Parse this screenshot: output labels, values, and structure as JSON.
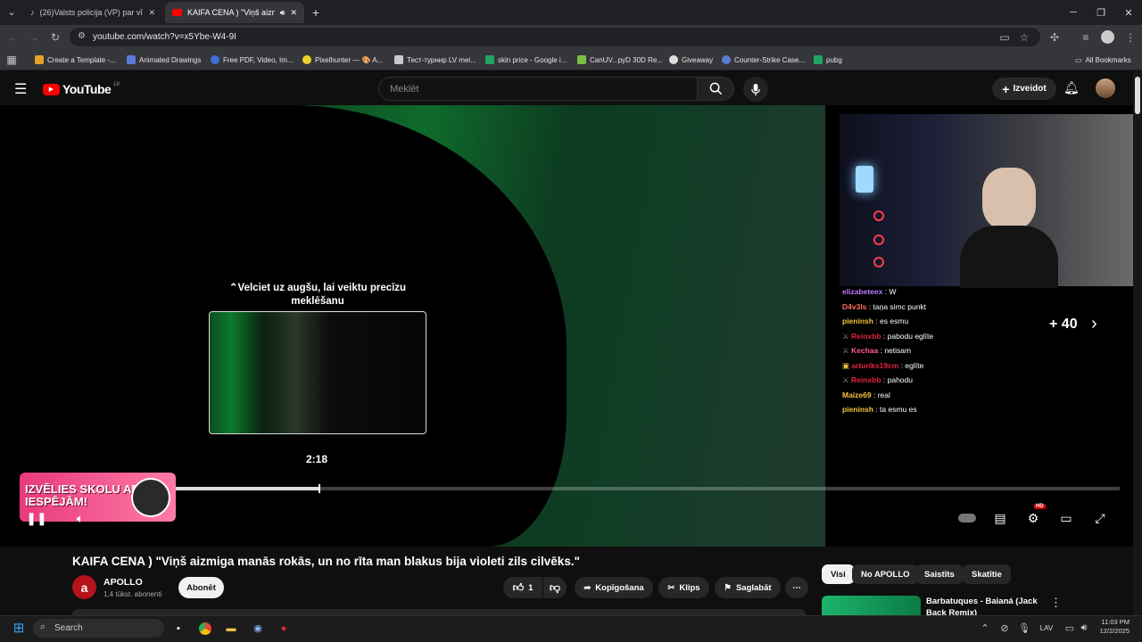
{
  "browser": {
    "tabs": [
      {
        "label": "(26)Valsts policija (VP) par vīrieš",
        "active": false
      },
      {
        "label": "KAIFA CENA ) \"Viņš aizmiga",
        "active": true
      }
    ],
    "new_tab": "+",
    "url": "youtube.com/watch?v=x5Ybe-W4-9I",
    "bookmarks": [
      {
        "label": "Create a Template -...",
        "color": "#e8a02b"
      },
      {
        "label": "Animated Drawings",
        "color": "#5b7bd6"
      },
      {
        "label": "Free PDF, Video, Im...",
        "color": "#3d6fd9"
      },
      {
        "label": "Pixelhunter — 🎨 A...",
        "color": "#f0d02a"
      },
      {
        "label": "Тест-турнир LV mei...",
        "color": "#c9c9c9"
      },
      {
        "label": "skin price - Google i...",
        "color": "#1fa463"
      },
      {
        "label": "CanUV...pyD 30D Re...",
        "color": "#7ac043"
      },
      {
        "label": "Giveaway",
        "color": "#dddddd"
      },
      {
        "label": "Counter-Strike Case...",
        "color": "#5b7bd6"
      },
      {
        "label": "pubg",
        "color": "#1fa463"
      }
    ],
    "all_bookmarks": "All Bookmarks"
  },
  "youtube": {
    "logo": "YouTube",
    "logo_country": "LV",
    "search_placeholder": "Meklēt",
    "create_label": "Izveidot"
  },
  "player": {
    "seek_hint": "Velciet uz augšu, lai veiktu precīzu meklēšanu",
    "time_tooltip": "2:18",
    "progress": 0.153,
    "promo_text": "IZVĒLIES SKOLU AR IESPĒJĀM!",
    "overlay_more": "+ 40",
    "hd_badge": "HD",
    "chat": [
      {
        "name": "elizabeteex",
        "msg": "W",
        "color": "#c07bff",
        "badge": false
      },
      {
        "name": "D4v3ls",
        "msg": "taņa simc punkt",
        "color": "#ff6b5a",
        "badge": false
      },
      {
        "name": "pieninsh",
        "msg": "es esmu",
        "color": "#f5c342",
        "badge": false
      },
      {
        "name": "Reinxbb",
        "msg": "pabodu eglīte",
        "color": "#e0243c",
        "badge": true
      },
      {
        "name": "Kechaa",
        "msg": "netisam",
        "color": "#ff5a8a",
        "badge": true
      },
      {
        "name": "arturiks19cm",
        "msg": "eglīte",
        "color": "#e0243c",
        "badge": true
      },
      {
        "name": "Reinxbb",
        "msg": "pahodu",
        "color": "#e0243c",
        "badge": true
      },
      {
        "name": "Maize69",
        "msg": "real",
        "color": "#f5c342",
        "badge": false
      },
      {
        "name": "pieninsh",
        "msg": "ta esmu es",
        "color": "#f5c342",
        "badge": false
      }
    ]
  },
  "video": {
    "title": "KAIFA CENA ) \"Viņš aizmiga manās rokās, un no rīta man blakus bija violeti zils cilvēks.\"",
    "channel": "APOLLO",
    "channel_initial": "a",
    "subscribers": "1,4 tūkst. abonenti",
    "subscribe": "Abonēt",
    "likes": "1",
    "share": "Kopīgošana",
    "clip": "Klips",
    "save": "Saglabāt"
  },
  "recommendations": {
    "chips": [
      "Visi",
      "No APOLLO",
      "Saistīts",
      "Skatītie"
    ],
    "first_title": "Barbatuques - Baianá (Jack Back Remix)"
  },
  "taskbar": {
    "search": "Search",
    "lang": "LAV",
    "time": "11:03 PM",
    "date": "12/2/2025"
  }
}
